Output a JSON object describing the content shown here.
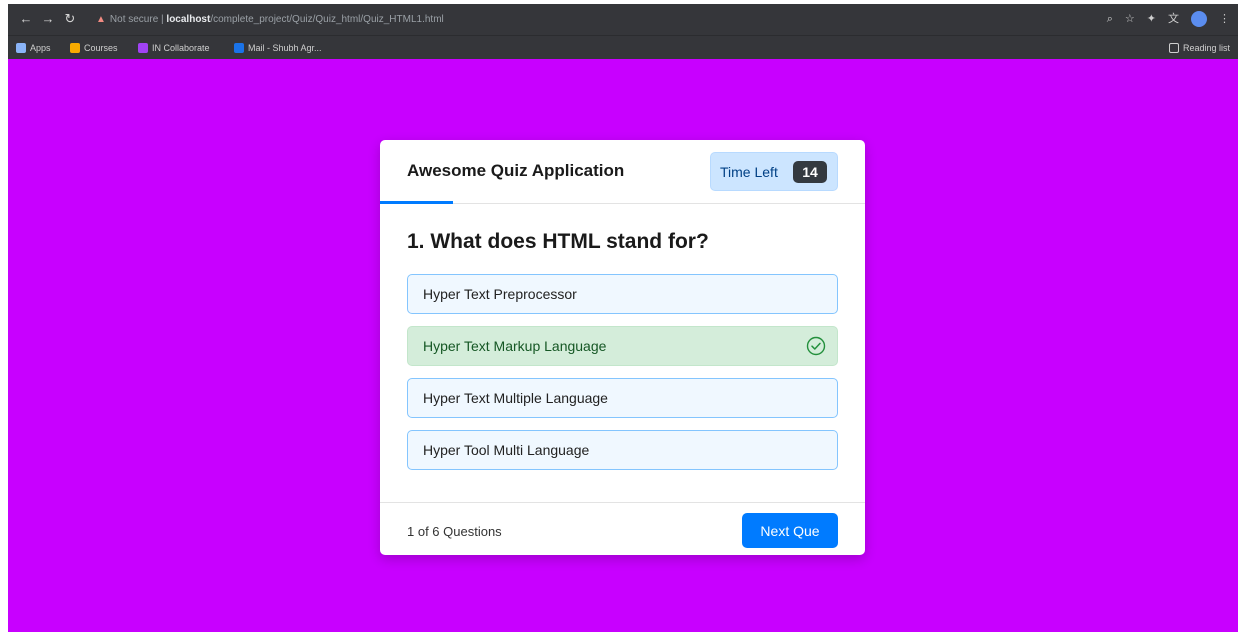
{
  "browser": {
    "security_label": "Not secure",
    "url_host": "localhost",
    "url_path": "/complete_project/Quiz/Quiz_html/Quiz_HTML1.html",
    "reading_list": "Reading list"
  },
  "bookmarks": [
    {
      "label": "Apps",
      "color": "#8ab4f8"
    },
    {
      "label": "Courses",
      "color": "#f9ab00"
    },
    {
      "label": "IN Collaborate",
      "color": "#a142f4"
    },
    {
      "label": "Mail - Shubh Agr...",
      "color": "#1a73e8"
    }
  ],
  "quiz": {
    "title": "Awesome Quiz Application",
    "timer_label": "Time Left",
    "timer_seconds": "14",
    "progress_fraction": 0.15,
    "question": "1. What does HTML stand for?",
    "options": [
      {
        "text": "Hyper Text Preprocessor",
        "state": "default"
      },
      {
        "text": "Hyper Text Markup Language",
        "state": "correct"
      },
      {
        "text": "Hyper Text Multiple Language",
        "state": "default"
      },
      {
        "text": "Hyper Tool Multi Language",
        "state": "default"
      }
    ],
    "count_text": "1 of 6 Questions",
    "next_label": "Next Que"
  },
  "colors": {
    "page_bg": "#c800ff",
    "accent": "#007bff",
    "correct_bg": "#d4edda",
    "option_bg": "#f0f8ff"
  }
}
